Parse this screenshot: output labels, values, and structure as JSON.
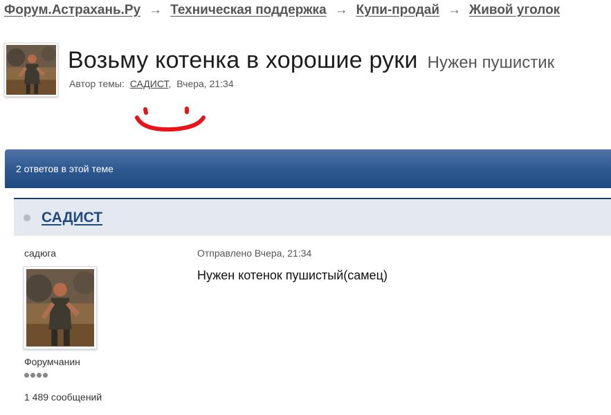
{
  "breadcrumbs": [
    {
      "label": "Форум.Астрахань.Ру"
    },
    {
      "label": "Техническая поддержка"
    },
    {
      "label": "Купи-продай"
    },
    {
      "label": "Живой уголок"
    }
  ],
  "breadcrumb_separator": "→",
  "topic": {
    "title": "Возьму котенка в хорошие руки",
    "description": "Нужен пушистик",
    "author_prefix": "Автор темы:",
    "author": "САДИСТ",
    "date_sep": ",",
    "date": "Вчера, 21:34"
  },
  "annotation": {
    "color": "#e8141a",
    "icon": "smile-drawing"
  },
  "replies_bar": {
    "text": "2 ответов в этой теме"
  },
  "post": {
    "author": "САДИСТ",
    "user_title": "садюга",
    "group": "Форумчанин",
    "pips": 4,
    "posts_count": "1 489 сообщений",
    "date": "Отправлено Вчера, 21:34",
    "text": "Нужен котенок пушистый(самец)"
  },
  "colors": {
    "accent": "#1f4a80",
    "bar_top": "#4f74a6",
    "header_bg": "#e4e9f0"
  }
}
